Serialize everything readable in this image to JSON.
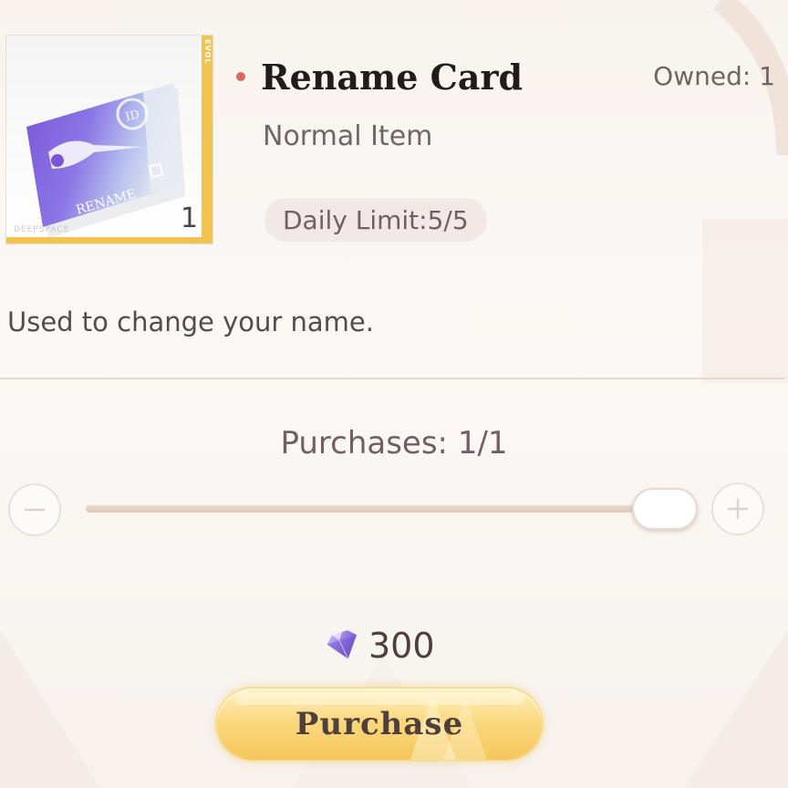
{
  "item": {
    "title": "Rename Card",
    "type_label": "Normal Item",
    "owned_text": "Owned: 1",
    "daily_limit_text": "Daily Limit:5/5",
    "description": "Used to change your name.",
    "card_text": "RENAME",
    "card_badge": "ID",
    "icon_count": "1",
    "icon_side_label": "EVOL",
    "icon_brand": "DEEPSPACE"
  },
  "purchase": {
    "purchases_text": "Purchases: 1/1",
    "quantity_fraction": 1.0,
    "price": "300",
    "currency_icon": "diamond-icon",
    "button_label": "Purchase"
  },
  "colors": {
    "accent_gold": "#f2c34f",
    "title_dot": "#d86a62",
    "text_dark": "#231b19"
  }
}
